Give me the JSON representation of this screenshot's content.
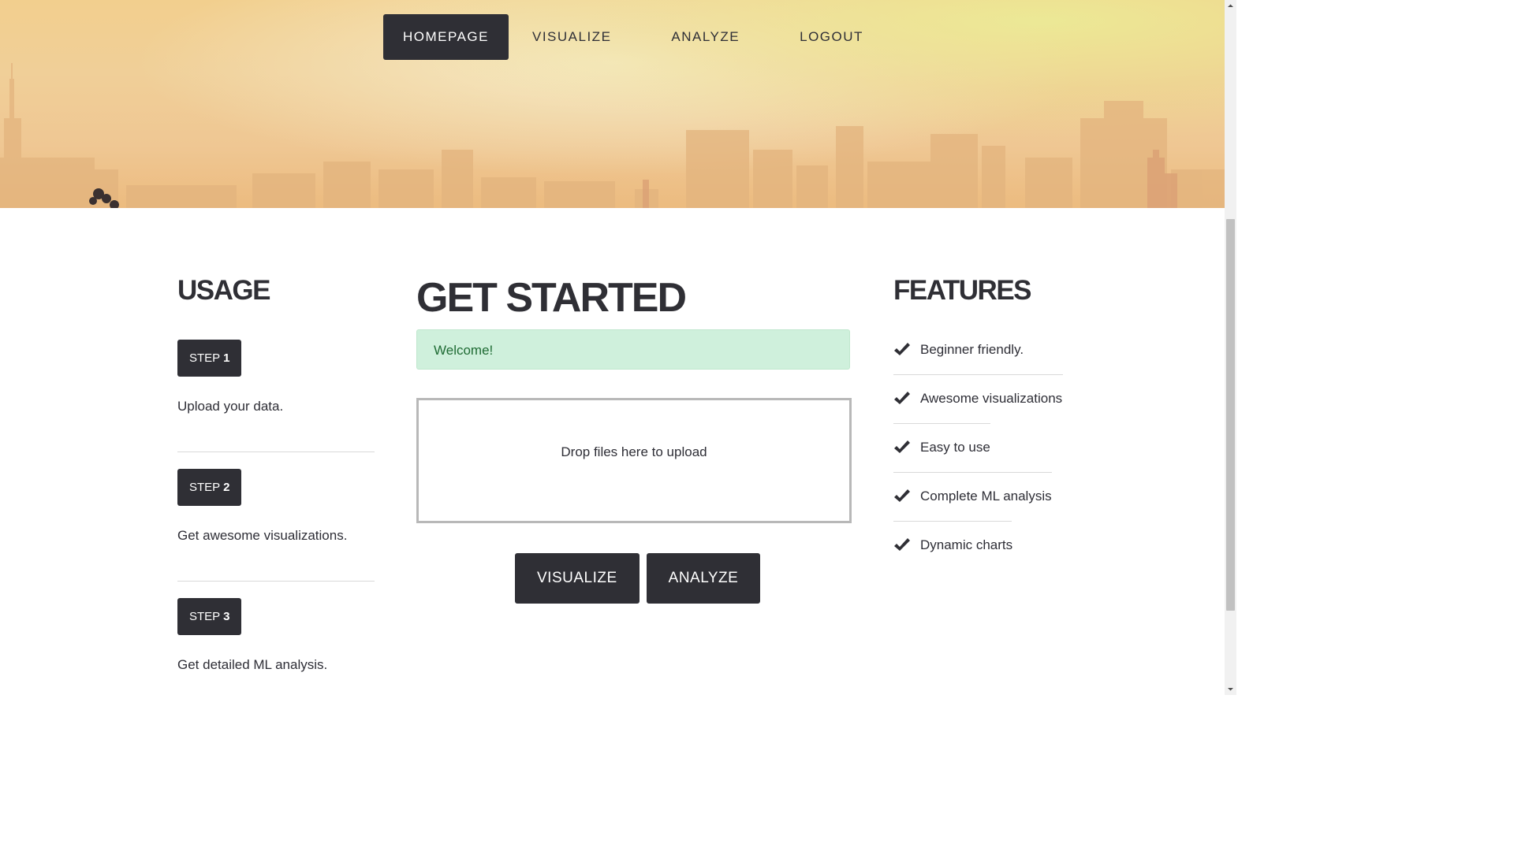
{
  "nav": {
    "items": [
      {
        "label": "HOMEPAGE",
        "active": true
      },
      {
        "label": "VISUALIZE",
        "active": false
      },
      {
        "label": "ANALYZE",
        "active": false
      },
      {
        "label": "LOGOUT",
        "active": false
      }
    ]
  },
  "usage": {
    "title": "USAGE",
    "steps": [
      {
        "prefix": "STEP",
        "number": "1",
        "description": "Upload your data."
      },
      {
        "prefix": "STEP",
        "number": "2",
        "description": "Get awesome visualizations."
      },
      {
        "prefix": "STEP",
        "number": "3",
        "description": "Get detailed ML analysis."
      }
    ]
  },
  "main": {
    "title": "GET STARTED",
    "alert": "Welcome!",
    "dropzone": "Drop files here to upload",
    "buttons": {
      "visualize": "VISUALIZE",
      "analyze": "ANALYZE"
    }
  },
  "features": {
    "title": "FEATURES",
    "icon": "check-icon",
    "items": [
      "Beginner friendly.",
      "Awesome visualizations",
      "Easy to use",
      "Complete ML analysis",
      "Dynamic charts"
    ]
  },
  "colors": {
    "dark": "#2f2f35",
    "alert_bg": "#cff0dc",
    "alert_text": "#1f6b34"
  }
}
